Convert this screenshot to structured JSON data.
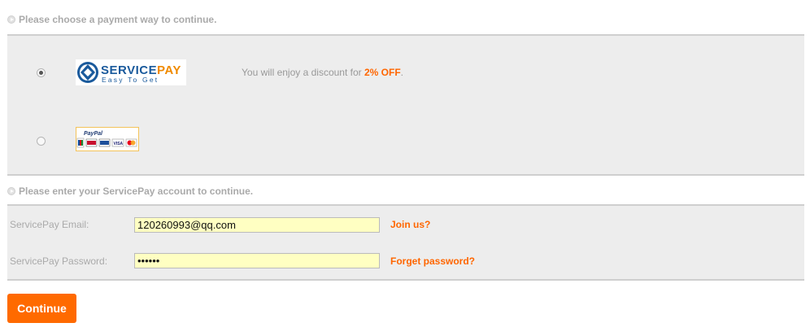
{
  "payment_section": {
    "title": "Please choose a payment way to continue.",
    "options": [
      {
        "name": "ServicePay",
        "logo_text_service": "SERVICE",
        "logo_text_pay": "PAY",
        "logo_tagline": "Easy To Get",
        "selected": true,
        "promo_prefix": "You will enjoy a discount for ",
        "promo_highlight": "2% OFF",
        "promo_suffix": "."
      },
      {
        "name": "PayPal",
        "logo_text": "PayPal",
        "cards": [
          "JCB",
          "pay",
          "VISA",
          "MC"
        ],
        "selected": false
      }
    ]
  },
  "account_section": {
    "title": "Please enter your ServicePay account to continue.",
    "email_label": "ServicePay Email:",
    "email_value": "120260993@qq.com",
    "password_label": "ServicePay Password:",
    "password_value": "123456",
    "join_link": "Join us?",
    "forget_link": "Forget password?"
  },
  "continue_button": "Continue",
  "colors": {
    "accent": "#ff6600",
    "button": "#ff6a00",
    "panel_bg": "#ededed",
    "input_bg": "#ffffc2",
    "servicepay_blue": "#1a5a9c"
  }
}
